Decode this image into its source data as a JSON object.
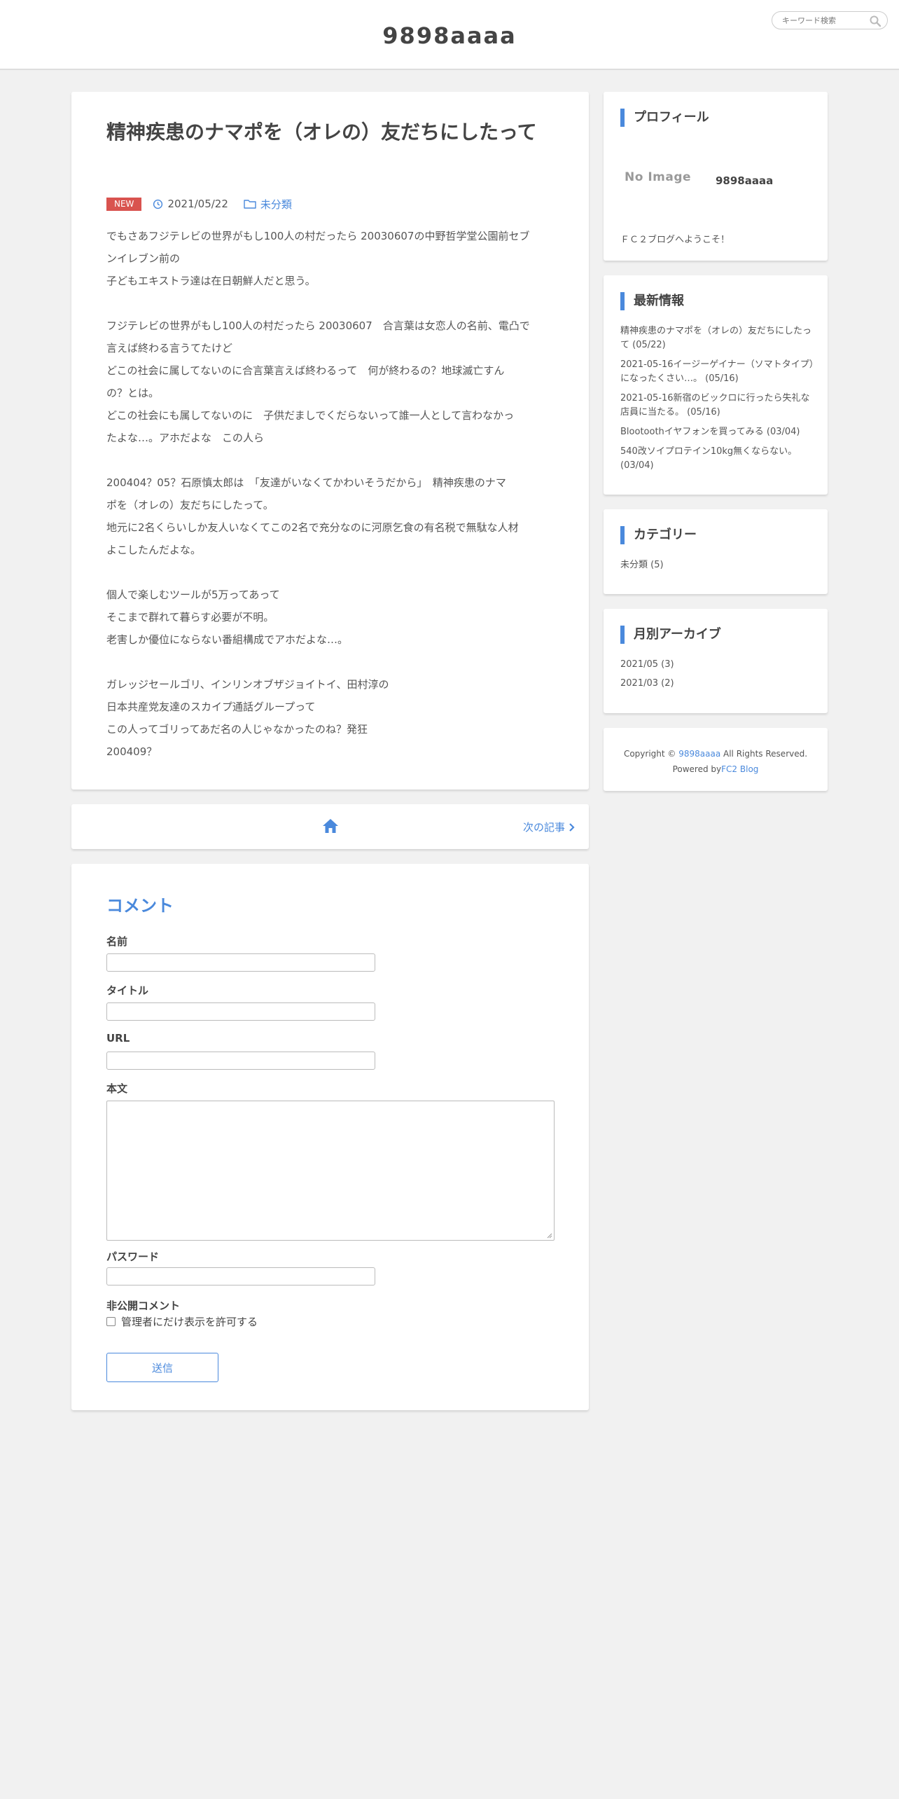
{
  "header": {
    "site_title": "9898aaaa",
    "search_placeholder": "キーワード検索"
  },
  "article": {
    "title": "精神疾患のナマポを（オレの）友だちにしたって",
    "badge": "NEW",
    "date": "2021/05/22",
    "category": "未分類",
    "lines": [
      "でもさあフジテレビの世界がもし100人の村だったら 20030607の中野哲学堂公園前セブ",
      "ンイレブン前の",
      "子どもエキストラ達は在日朝鮮人だと思う。",
      "",
      "フジテレビの世界がもし100人の村だったら 20030607　合言葉は女恋人の名前、電凸で",
      "言えば終わる言うてたけど",
      "どこの社会に属してないのに合言葉言えば終わるって　何が終わるの？地球滅亡すん",
      "の？とは。",
      "どこの社会にも属してないのに　子供だましでくだらないって誰一人として言わなかっ",
      "たよな…。アホだよな　この人ら",
      "",
      "200404？05？石原慎太郎は　「友達がいなくてかわいそうだから」　精神疾患のナマ",
      "ポを（オレの）友だちにしたって。",
      "地元に2名くらいしか友人いなくてこの2名で充分なのに河原乞食の有名税で無駄な人材",
      "よこしたんだよな。",
      "",
      "個人で楽しむツールが5万ってあって",
      "そこまで群れて暮らす必要が不明。",
      "老害しか優位にならない番組構成でアホだよな…。",
      "",
      "ガレッジセールゴリ、インリンオブザジョイトイ、田村淳の",
      "日本共産党友達のスカイプ通話グループって",
      "この人ってゴリってあだ名の人じゃなかったのね？発狂",
      "200409？"
    ]
  },
  "nav": {
    "next_label": "次の記事"
  },
  "comment": {
    "heading": "コメント",
    "name_label": "名前",
    "title_label": "タイトル",
    "url_label": "URL",
    "body_label": "本文",
    "password_label": "パスワード",
    "private_label": "非公開コメント",
    "private_checkbox_label": "管理者にだけ表示を許可する",
    "submit_label": "送信"
  },
  "sidebar": {
    "profile": {
      "heading": "プロフィール",
      "no_image": "No Image",
      "name": "9898aaaa",
      "description": "ＦＣ２ブログへようこそ！"
    },
    "recent": {
      "heading": "最新情報",
      "items": [
        "精神疾患のナマポを（オレの）友だちにしたって (05/22)",
        "2021-05-16イージーゲイナー（ソマトタイプ）になったくさい…。 (05/16)",
        "2021-05-16新宿のビックロに行ったら失礼な店員に当たる。 (05/16)",
        "Blootoothイヤフォンを買ってみる (03/04)",
        "540改ソイプロテイン10kg無くならない。 (03/04)"
      ]
    },
    "categories": {
      "heading": "カテゴリー",
      "items": [
        "未分類 (5)"
      ]
    },
    "archive": {
      "heading": "月別アーカイブ",
      "items": [
        "2021/05 (3)",
        "2021/03 (2)"
      ]
    },
    "footer": {
      "copyright_prefix": "Copyright ©",
      "site_link": "9898aaaa",
      "rights": "All Rights Reserved.",
      "powered_prefix": "Powered by",
      "powered_link": "FC2 Blog"
    }
  },
  "colors": {
    "accent": "#4a89dc",
    "new_badge": "#d9534f",
    "background": "#f1f1f1"
  }
}
